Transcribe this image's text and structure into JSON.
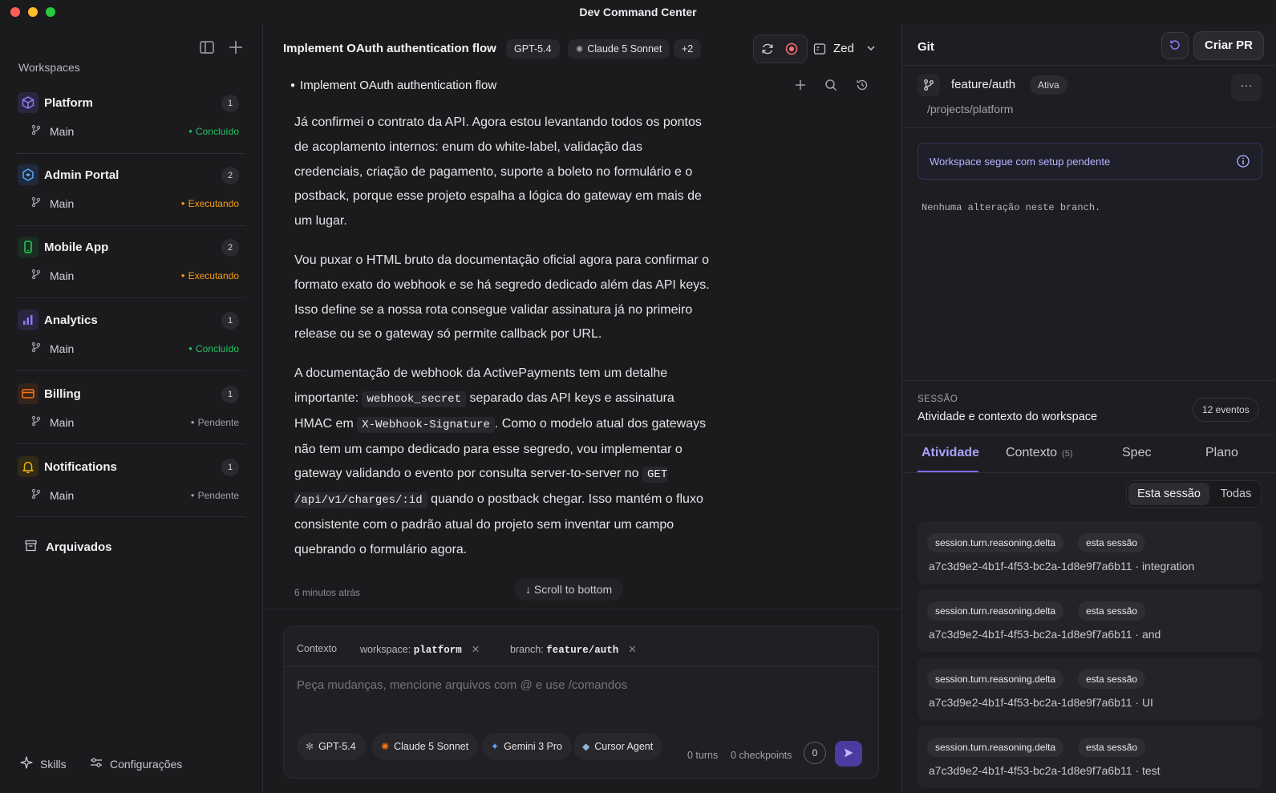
{
  "window": {
    "title": "Dev Command Center",
    "traffic_lights": [
      "#ff5f57",
      "#febc2e",
      "#28c840"
    ]
  },
  "sidebar": {
    "heading": "Workspaces",
    "workspaces": [
      {
        "name": "Platform",
        "count": "1",
        "branch": "Main",
        "status": "Concluído",
        "status_color": "#22c55e",
        "icon": "cube-icon",
        "icon_color": "#8b7cf6"
      },
      {
        "name": "Admin Portal",
        "count": "2",
        "branch": "Main",
        "status": "Executando",
        "status_color": "#f59e0b",
        "icon": "hexagon-icon",
        "icon_color": "#60a5fa"
      },
      {
        "name": "Mobile App",
        "count": "2",
        "branch": "Main",
        "status": "Executando",
        "status_color": "#f59e0b",
        "icon": "phone-icon",
        "icon_color": "#22c55e"
      },
      {
        "name": "Analytics",
        "count": "1",
        "branch": "Main",
        "status": "Concluído",
        "status_color": "#22c55e",
        "icon": "bar-chart-icon",
        "icon_color": "#8b7cf6"
      },
      {
        "name": "Billing",
        "count": "1",
        "branch": "Main",
        "status": "Pendente",
        "status_color": "#a1a1aa",
        "icon": "credit-card-icon",
        "icon_color": "#f97316"
      },
      {
        "name": "Notifications",
        "count": "1",
        "branch": "Main",
        "status": "Pendente",
        "status_color": "#a1a1aa",
        "icon": "bell-icon",
        "icon_color": "#eab308"
      }
    ],
    "archived": "Arquivados",
    "skills": "Skills",
    "settings": "Configurações"
  },
  "chat": {
    "title": "Implement OAuth authentication flow",
    "model_pills": [
      "GPT-5.4",
      "Claude 5 Sonnet",
      "+2"
    ],
    "editor": "Zed",
    "thread_item": "Implement OAuth authentication flow",
    "paragraphs": {
      "p1": "Já confirmei o contrato da API. Agora estou levantando todos os pontos de acoplamento internos: enum do white-label, validação das credenciais, criação de pagamento, suporte a boleto no formulário e o postback, porque esse projeto espalha a lógica do gateway em mais de um lugar.",
      "p2": "Vou puxar o HTML bruto da documentação oficial agora para confirmar o formato exato do webhook e se há segredo dedicado além das API keys. Isso define se a nossa rota consegue validar assinatura já no primeiro release ou se o gateway só permite callback por URL.",
      "p3_a": "A documentação de webhook da ActivePayments tem um detalhe importante: ",
      "p3_code1": "webhook_secret",
      "p3_b": " separado das API keys e assinatura HMAC em ",
      "p3_code2": "X-Webhook-Signature",
      "p3_c": ". Como o modelo atual dos gateways não tem um campo dedicado para esse segredo, vou implementar o gateway validando o evento por consulta server-to-server no ",
      "p3_code3": "GET /api/v1/charges/:id",
      "p3_d": " quando o postback chegar. Isso mantém o fluxo consistente com o padrão atual do projeto sem inventar um campo quebrando o formulário agora."
    },
    "timestamp": "6 minutos atrás",
    "scroll_to_bottom": "↓ Scroll to bottom"
  },
  "composer": {
    "context_label": "Contexto",
    "workspace_label": "workspace:",
    "workspace_value": "platform",
    "branch_label": "branch:",
    "branch_value": "feature/auth",
    "placeholder": "Peça mudanças, mencione arquivos com @ e use /comandos",
    "models": [
      "GPT-5.4",
      "Claude 5 Sonnet",
      "Gemini 3 Pro",
      "Cursor Agent"
    ],
    "turns": "0 turns",
    "checkpoints": "0 checkpoints",
    "checkpoint_count": "0"
  },
  "git": {
    "title": "Git",
    "create_pr": "Criar PR",
    "branch": "feature/auth",
    "branch_badge": "Ativa",
    "more": "···",
    "path": "/projects/platform",
    "setup_notice": "Workspace segue com setup pendente",
    "no_changes": "Nenhuma alteração neste branch."
  },
  "session": {
    "label": "SESSÃO",
    "title": "Atividade e contexto do workspace",
    "event_count": "12 eventos",
    "tabs": [
      {
        "label": "Atividade",
        "badge": ""
      },
      {
        "label": "Contexto",
        "badge": "(5)"
      },
      {
        "label": "Spec",
        "badge": ""
      },
      {
        "label": "Plano",
        "badge": ""
      }
    ],
    "filter": [
      "Esta sessão",
      "Todas"
    ],
    "events": [
      {
        "tag": "session.turn.reasoning.delta",
        "scope": "esta sessão",
        "desc": "a7c3d9e2-4b1f-4f53-bc2a-1d8e9f7a6b11 · integration"
      },
      {
        "tag": "session.turn.reasoning.delta",
        "scope": "esta sessão",
        "desc": "a7c3d9e2-4b1f-4f53-bc2a-1d8e9f7a6b11 · and"
      },
      {
        "tag": "session.turn.reasoning.delta",
        "scope": "esta sessão",
        "desc": "a7c3d9e2-4b1f-4f53-bc2a-1d8e9f7a6b11 · UI"
      },
      {
        "tag": "session.turn.reasoning.delta",
        "scope": "esta sessão",
        "desc": "a7c3d9e2-4b1f-4f53-bc2a-1d8e9f7a6b11 · test"
      }
    ]
  },
  "colors": {
    "accent": "#7c6cf0",
    "send_button": "#4c3ba0",
    "notice_text": "#b9b4ff"
  }
}
